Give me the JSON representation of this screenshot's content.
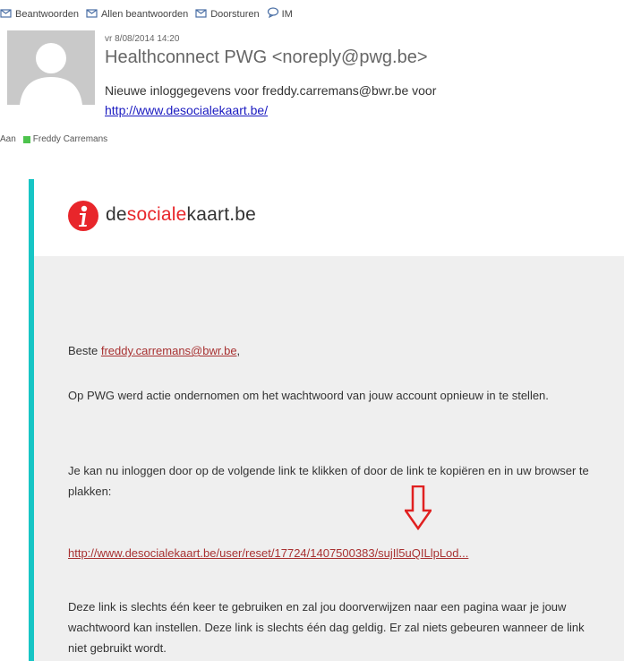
{
  "toolbar": {
    "reply": "Beantwoorden",
    "reply_all": "Allen beantwoorden",
    "forward": "Doorsturen",
    "im": "IM"
  },
  "header": {
    "date": "vr 8/08/2014 14:20",
    "sender": "Healthconnect PWG <noreply@pwg.be>",
    "subject_line1": "Nieuwe inloggegevens voor freddy.carremans@bwr.be voor",
    "subject_link": "http://www.desocialekaart.be/",
    "to_label": "Aan",
    "recipient": "Freddy Carremans"
  },
  "logo": {
    "part1": "de",
    "part2": "sociale",
    "part3": "kaart.be"
  },
  "body": {
    "greeting": "Beste ",
    "greeting_email": "freddy.carremans@bwr.be",
    "greeting_end": ",",
    "para1": "Op PWG werd actie ondernomen om het wachtwoord van jouw account opnieuw in te stellen.",
    "para2": "Je kan nu inloggen door op de volgende link te klikken of door de link te kopiëren en in uw browser te plakken:",
    "reset_link": "http://www.desocialekaart.be/user/reset/17724/1407500383/sujIl5uQILlpLod...",
    "para3": "Deze link is slechts één keer te gebruiken en zal jou doorverwijzen naar een pagina waar je jouw wachtwoord kan instellen. Deze link is slechts één dag geldig. Er zal niets gebeuren wanneer de link niet gebruikt wordt."
  },
  "colors": {
    "stripe": "#17c5c5",
    "logo_red": "#e8262b",
    "link": "#a83232",
    "arrow": "#e02020"
  }
}
